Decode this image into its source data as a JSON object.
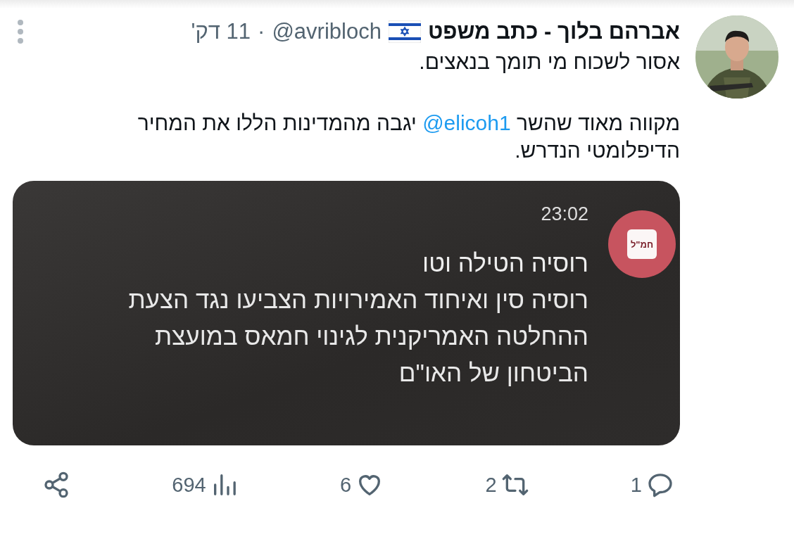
{
  "tweet": {
    "author": {
      "name": "אברהם בלוך - כתב משפט",
      "handle": "@avribloch",
      "separator": "·",
      "time": "11 דק'"
    },
    "paragraphs": [
      [
        {
          "kind": "text",
          "text": "אסור לשכוח מי תומך בנאצים."
        }
      ],
      [
        {
          "kind": "text",
          "text": "מקווה מאוד שהשר "
        },
        {
          "kind": "mention",
          "text": "@elicoh1"
        },
        {
          "kind": "text",
          "text": " יגבה מהמדינות הללו את המחיר הדיפלומטי הנדרש."
        }
      ]
    ],
    "embed": {
      "time": "23:02",
      "logo": "חמ\"ל",
      "headline": "רוסיה הטילה וטו",
      "lines": [
        "רוסיה סין ואיחוד האמירויות הצביעו נגד הצעת",
        "ההחלטה האמריקנית לגינוי חמאס במועצת",
        "הביטחון של האו\"ם"
      ]
    },
    "actions": [
      {
        "kind": "reply",
        "count": "1"
      },
      {
        "kind": "retweet",
        "count": "2"
      },
      {
        "kind": "like",
        "count": "6"
      },
      {
        "kind": "views",
        "count": "694"
      },
      {
        "kind": "share"
      }
    ]
  }
}
